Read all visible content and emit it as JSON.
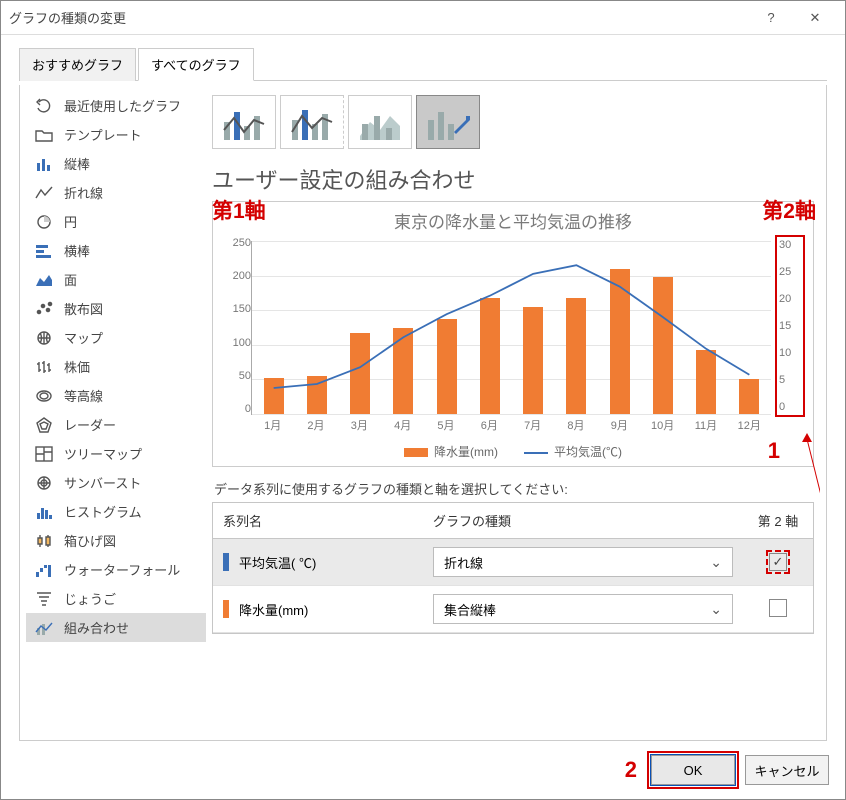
{
  "dialog": {
    "title": "グラフの種類の変更",
    "help": "?",
    "close": "✕"
  },
  "tabs": {
    "recommend": "おすすめグラフ",
    "all": "すべてのグラフ"
  },
  "sidebar": {
    "items": [
      {
        "icon": "undo",
        "label": "最近使用したグラフ"
      },
      {
        "icon": "folder",
        "label": "テンプレート"
      },
      {
        "icon": "column",
        "label": "縦棒"
      },
      {
        "icon": "line",
        "label": "折れ線"
      },
      {
        "icon": "pie",
        "label": "円"
      },
      {
        "icon": "barh",
        "label": "横棒"
      },
      {
        "icon": "area",
        "label": "面"
      },
      {
        "icon": "scatter",
        "label": "散布図"
      },
      {
        "icon": "map",
        "label": "マップ"
      },
      {
        "icon": "stock",
        "label": "株価"
      },
      {
        "icon": "contour",
        "label": "等高線"
      },
      {
        "icon": "radar",
        "label": "レーダー"
      },
      {
        "icon": "treemap",
        "label": "ツリーマップ"
      },
      {
        "icon": "sunburst",
        "label": "サンバースト"
      },
      {
        "icon": "histogram",
        "label": "ヒストグラム"
      },
      {
        "icon": "boxplot",
        "label": "箱ひげ図"
      },
      {
        "icon": "waterfall",
        "label": "ウォーターフォール"
      },
      {
        "icon": "funnel",
        "label": "じょうご"
      },
      {
        "icon": "combo",
        "label": "組み合わせ"
      }
    ]
  },
  "heading": "ユーザー設定の組み合わせ",
  "annotations": {
    "axis1": "第1軸",
    "axis2": "第2軸",
    "n1": "1",
    "n2": "2"
  },
  "preview": {
    "title": "東京の降水量と平均気温の推移",
    "legend_bar": "降水量(mm)",
    "legend_line": "平均気温(℃)"
  },
  "instruction": "データ系列に使用するグラフの種類と軸を選択してください:",
  "series_table": {
    "header_name": "系列名",
    "header_type": "グラフの種類",
    "header_axis": "第 2 軸",
    "rows": [
      {
        "color": "#3a6fb7",
        "name": "平均気温( ℃)",
        "type": "折れ線",
        "checked": true
      },
      {
        "color": "#f07c33",
        "name": "降水量(mm)",
        "type": "集合縦棒",
        "checked": false
      }
    ]
  },
  "footer": {
    "ok": "OK",
    "cancel": "キャンセル"
  },
  "chart_data": {
    "type": "combo",
    "title": "東京の降水量と平均気温の推移",
    "categories": [
      "1月",
      "2月",
      "3月",
      "4月",
      "5月",
      "6月",
      "7月",
      "8月",
      "9月",
      "10月",
      "11月",
      "12月"
    ],
    "y1": {
      "label": "降水量(mm)",
      "ylim": [
        0,
        250
      ],
      "ticks": [
        0,
        50,
        100,
        150,
        200,
        250
      ]
    },
    "y2": {
      "label": "平均気温(℃)",
      "ylim": [
        0,
        30
      ],
      "ticks": [
        0,
        5,
        10,
        15,
        20,
        25,
        30
      ]
    },
    "series": [
      {
        "name": "降水量(mm)",
        "kind": "bar",
        "axis": "y1",
        "values": [
          52,
          55,
          117,
          125,
          138,
          168,
          154,
          168,
          210,
          198,
          93,
          51
        ]
      },
      {
        "name": "平均気温(℃)",
        "kind": "line",
        "axis": "y2",
        "values": [
          5.2,
          5.9,
          8.8,
          14.0,
          18.0,
          21.2,
          25.0,
          26.5,
          22.8,
          17.5,
          12.0,
          7.5
        ]
      }
    ]
  }
}
